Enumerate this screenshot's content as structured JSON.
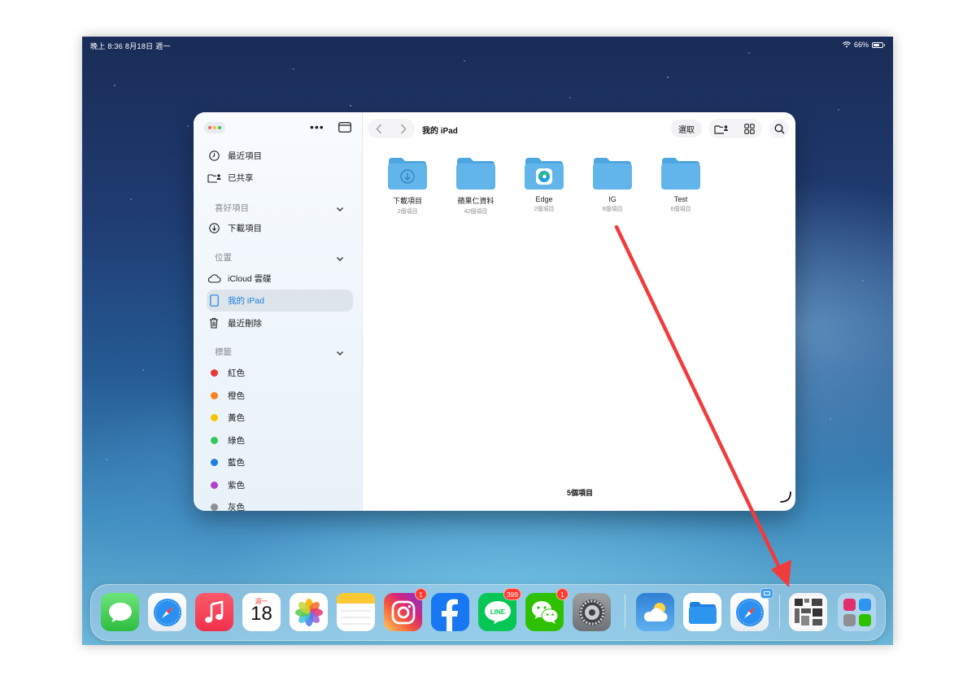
{
  "status_bar": {
    "time_date": "晚上 8:36  8月18日 週一",
    "battery": "66%"
  },
  "sidebar": {
    "recent": "最近項目",
    "shared": "已共享",
    "favorites_header": "喜好項目",
    "favorites": [
      {
        "label": "下載項目",
        "icon": "download-icon"
      }
    ],
    "locations_header": "位置",
    "locations": [
      {
        "label": "iCloud 雲碟",
        "icon": "cloud-icon"
      },
      {
        "label": "我的 iPad",
        "icon": "ipad-icon",
        "selected": true
      },
      {
        "label": "最近刪除",
        "icon": "trash-icon"
      }
    ],
    "tags_header": "標籤",
    "tags": [
      {
        "label": "紅色",
        "color": "#e53935"
      },
      {
        "label": "橙色",
        "color": "#f5841f"
      },
      {
        "label": "黃色",
        "color": "#f7c600"
      },
      {
        "label": "綠色",
        "color": "#34c759"
      },
      {
        "label": "藍色",
        "color": "#1e7fe0"
      },
      {
        "label": "紫色",
        "color": "#b541c9"
      },
      {
        "label": "灰色",
        "color": "#8e8e93"
      }
    ]
  },
  "toolbar": {
    "title": "我的 iPad",
    "select_label": "選取"
  },
  "folders": [
    {
      "name": "下載項目",
      "count": "2個項目",
      "badge_icon": "download-icon"
    },
    {
      "name": "蘋果仁資料",
      "count": "42個項目",
      "badge_icon": ""
    },
    {
      "name": "Edge",
      "count": "2個項目",
      "badge_icon": "edge-icon"
    },
    {
      "name": "IG",
      "count": "6個項目",
      "badge_icon": ""
    },
    {
      "name": "Test",
      "count": "6個項目",
      "badge_icon": ""
    }
  ],
  "item_count": "5個項目",
  "dock": {
    "calendar": {
      "weekday": "週一",
      "day": "18"
    },
    "badges": {
      "instagram": "1",
      "line": "399",
      "wechat": "1"
    },
    "apps": [
      "messages-icon",
      "safari-icon",
      "music-icon",
      "calendar-icon",
      "photos-icon",
      "notes-icon",
      "instagram-icon",
      "facebook-icon",
      "line-icon",
      "wechat-icon",
      "settings-icon",
      "weather-icon",
      "files-icon",
      "safari-icon",
      "app-library-icon"
    ]
  },
  "colors": {
    "accent": "#1e7fe0",
    "folder": "#62b5ea",
    "arrow": "#f03c3c"
  }
}
